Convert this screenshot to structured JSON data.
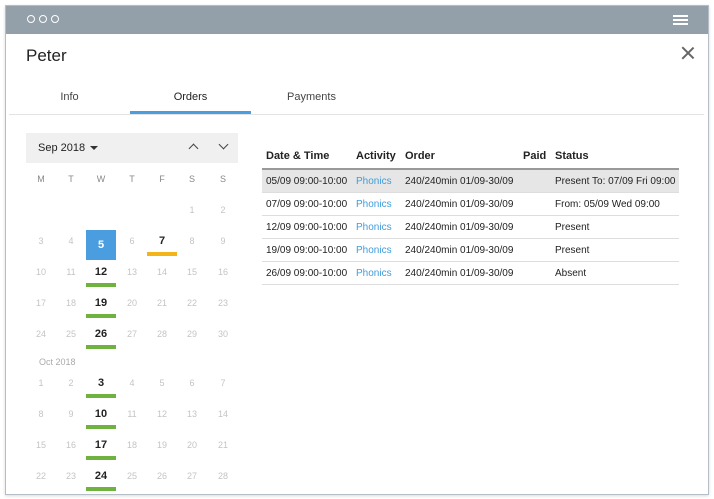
{
  "header": {
    "name": "Peter"
  },
  "tabs": [
    {
      "label": "Info"
    },
    {
      "label": "Orders"
    },
    {
      "label": "Payments"
    }
  ],
  "calendar": {
    "month_label": "Sep 2018",
    "next_month_label": "Oct 2018",
    "weekdays": [
      "M",
      "T",
      "W",
      "T",
      "F",
      "S",
      "S"
    ],
    "bar_colors": {
      "green": "#6fb23f",
      "orange": "#f3b419"
    },
    "sep_rows": [
      [
        "",
        "",
        "",
        "",
        "",
        "1",
        "2"
      ],
      [
        "3",
        "4",
        "5",
        "6",
        "7",
        "8",
        "9"
      ],
      [
        "10",
        "11",
        "12",
        "13",
        "14",
        "15",
        "16"
      ],
      [
        "17",
        "18",
        "19",
        "20",
        "21",
        "22",
        "23"
      ],
      [
        "24",
        "25",
        "26",
        "27",
        "28",
        "29",
        "30"
      ]
    ],
    "oct_rows": [
      [
        "1",
        "2",
        "3",
        "4",
        "5",
        "6",
        "7"
      ],
      [
        "8",
        "9",
        "10",
        "11",
        "12",
        "13",
        "14"
      ],
      [
        "15",
        "16",
        "17",
        "18",
        "19",
        "20",
        "21"
      ],
      [
        "22",
        "23",
        "24",
        "25",
        "26",
        "27",
        "28"
      ]
    ],
    "today": "5",
    "highlighted": [
      "7",
      "12",
      "19",
      "26",
      "3",
      "10",
      "17",
      "24"
    ]
  },
  "orders_table": {
    "headers": [
      "Date & Time",
      "Activity",
      "Order",
      "Paid",
      "Status"
    ],
    "rows": [
      {
        "date": "05/09 09:00-10:00",
        "activity": "Phonics",
        "order": "240/240min 01/09-30/09",
        "paid": "",
        "status": "Present To: 07/09 Fri 09:00"
      },
      {
        "date": "07/09 09:00-10:00",
        "activity": "Phonics",
        "order": "240/240min 01/09-30/09",
        "paid": "",
        "status": "From: 05/09 Wed 09:00"
      },
      {
        "date": "12/09 09:00-10:00",
        "activity": "Phonics",
        "order": "240/240min 01/09-30/09",
        "paid": "",
        "status": "Present"
      },
      {
        "date": "19/09 09:00-10:00",
        "activity": "Phonics",
        "order": "240/240min 01/09-30/09",
        "paid": "",
        "status": "Present"
      },
      {
        "date": "26/09 09:00-10:00",
        "activity": "Phonics",
        "order": "240/240min 01/09-30/09",
        "paid": "",
        "status": "Absent"
      }
    ]
  }
}
